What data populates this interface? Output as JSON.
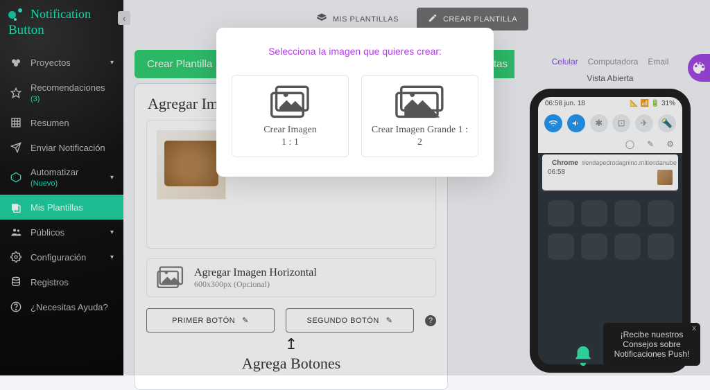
{
  "brand": {
    "top": "Notification",
    "bottom": "Button"
  },
  "sidebar": {
    "items": [
      {
        "label": "Proyectos",
        "icon": "projects-icon",
        "expandable": true
      },
      {
        "label": "Recomendaciones",
        "tag": "(3)",
        "icon": "star-icon"
      },
      {
        "label": "Resumen",
        "icon": "grid-icon"
      },
      {
        "label": "Enviar Notificación",
        "icon": "send-icon"
      },
      {
        "label": "Automatizar",
        "tag": "(Nuevo)",
        "icon": "automate-icon",
        "expandable": true
      },
      {
        "label": "Mis Plantillas",
        "icon": "templates-icon",
        "active": true
      },
      {
        "label": "Públicos",
        "icon": "audience-icon",
        "expandable": true
      },
      {
        "label": "Configuración",
        "icon": "gear-icon",
        "expandable": true
      },
      {
        "label": "Registros",
        "icon": "db-icon"
      },
      {
        "label": "¿Necesitas Ayuda?",
        "icon": "help-icon"
      }
    ]
  },
  "topbar": {
    "my_templates": "MIS PLANTILLAS",
    "create_template": "CREAR PLANTILLA"
  },
  "header": {
    "create_btn": "Crear Plantilla",
    "right_peek": "stas"
  },
  "section": {
    "title": "Agregar Imagen",
    "strip_title": "Agregar Imagen Horizontal",
    "strip_sub": "600x300px (Opcional)",
    "button1": "PRIMER BOTÓN",
    "button2": "SEGUNDO BOTÓN",
    "add_btns_arrow": "↥",
    "add_btns_label": "Agrega Botones"
  },
  "preview": {
    "tabs": {
      "mobile": "Celular",
      "desktop": "Computadora",
      "email": "Email"
    },
    "open_label": "Vista Abierta",
    "status": {
      "time": "06:58 jun. 18",
      "battery": "31%"
    },
    "notif": {
      "app": "Chrome",
      "site": "tiendapedrodagnino.mitiendanube",
      "time": "06:58"
    }
  },
  "toast": {
    "line1": "¡Recibe nuestros",
    "line2": "Consejos sobre",
    "line3": "Notificaciones Push!"
  },
  "modal": {
    "title": "Selecciona la imagen que quieres crear:",
    "card1_l1": "Crear Imagen",
    "card1_l2": "1 : 1",
    "card2_l1": "Crear Imagen Grande 1 :",
    "card2_l2": "2"
  }
}
